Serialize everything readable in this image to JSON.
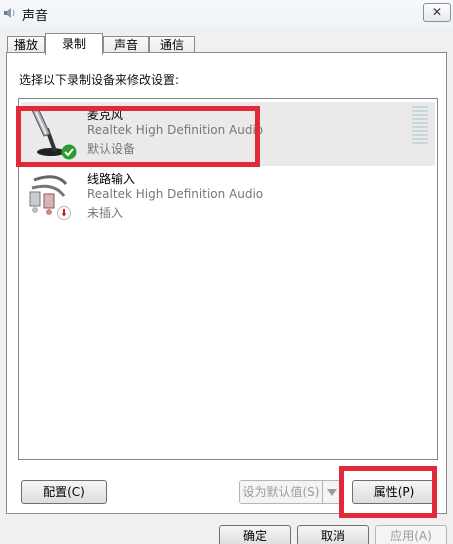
{
  "window": {
    "title": "声音",
    "close_glyph": "✕"
  },
  "tabs": [
    {
      "label": "播放",
      "active": false
    },
    {
      "label": "录制",
      "active": true
    },
    {
      "label": "声音",
      "active": false
    },
    {
      "label": "通信",
      "active": false
    }
  ],
  "recording": {
    "instruction": "选择以下录制设备来修改设置:",
    "devices": [
      {
        "name": "麦克风",
        "driver": "Realtek High Definition Audio",
        "status": "默认设备",
        "icon": "microphone-icon",
        "badge": "default-check-icon",
        "selected": true
      },
      {
        "name": "线路输入",
        "driver": "Realtek High Definition Audio",
        "status": "未插入",
        "icon": "line-in-cable-icon",
        "badge": "unplugged-icon",
        "selected": false
      }
    ]
  },
  "buttons": {
    "configure": "配置(C)",
    "set_default": "设为默认值(S)",
    "properties": "属性(P)",
    "ok": "确定",
    "cancel": "取消",
    "apply": "应用(A)"
  },
  "colors": {
    "highlight": "#e02a3a",
    "check_green": "#2e9b2e",
    "unplugged_red": "#d01818"
  }
}
